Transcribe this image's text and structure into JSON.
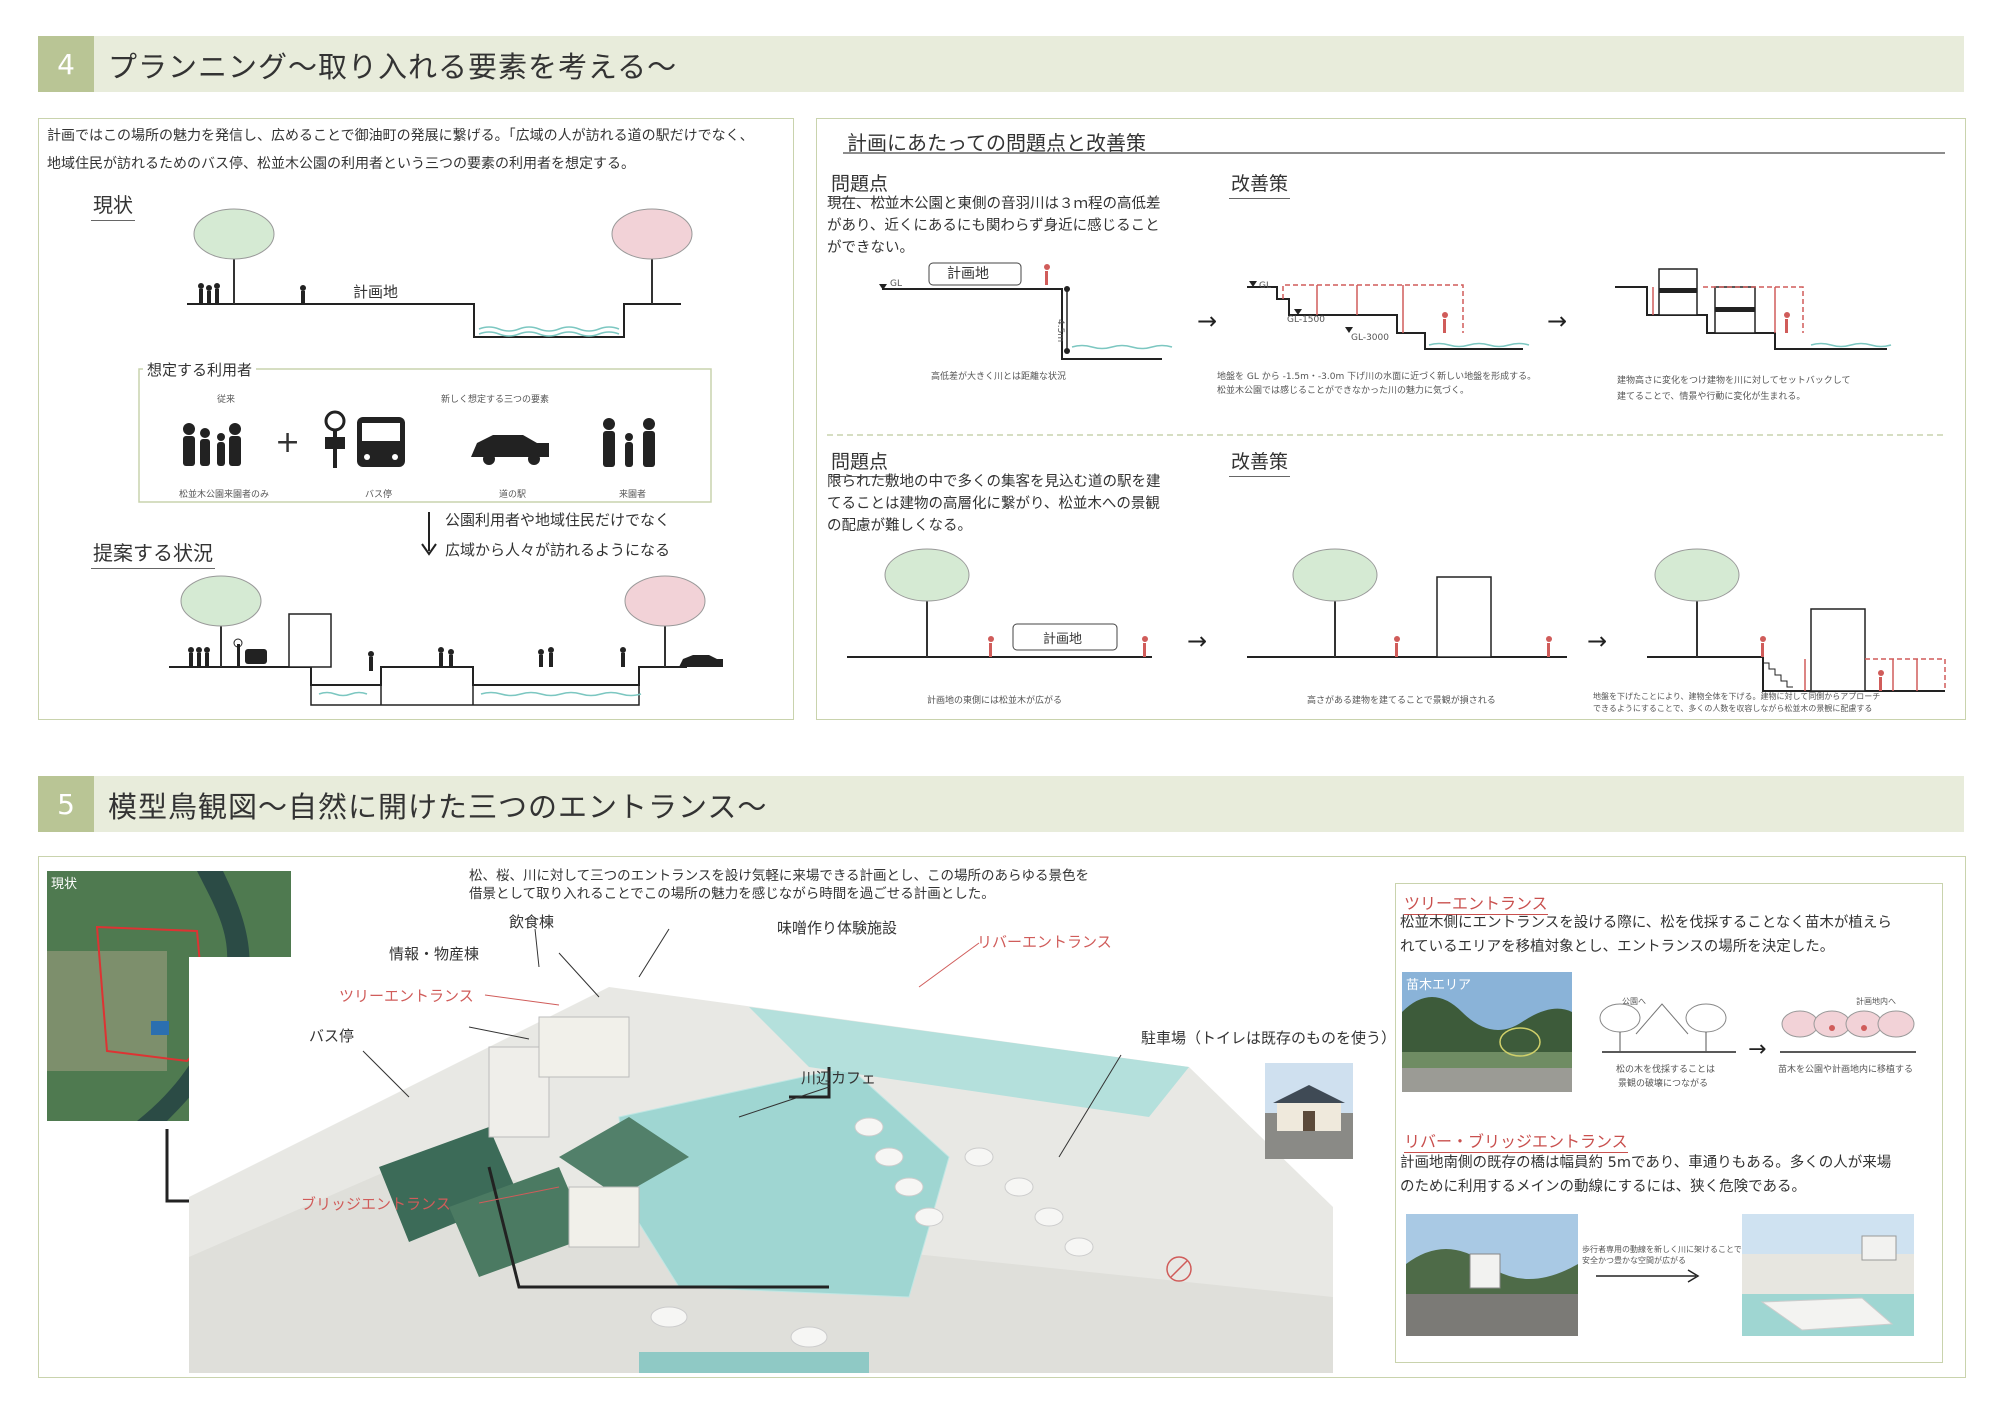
{
  "section4": {
    "num": "4",
    "title": "プランニング〜取り入れる要素を考える〜",
    "intro_line1": "計画ではこの場所の魅力を発信し、広めることで御油町の発展に繋げる。「広域の人が訪れる道の駅だけでなく、",
    "intro_line2": "地域住民が訪れるためのバス停、松並木公園の利用者という三つの要素の利用者を想定する。",
    "current_label": "現状",
    "site_label": "計画地",
    "users_title": "想定する利用者",
    "users_conventional": "従来",
    "users_new": "新しく想定する三つの要素",
    "user_park": "松並木公園来園者のみ",
    "user_bus": "バス停",
    "user_roadside": "道の駅",
    "user_visitor": "来園者",
    "plus": "+",
    "arrow_text1": "公園利用者や地域住民だけでなく",
    "arrow_text2": "広域から人々が訪れるようになる",
    "proposal_label": "提案する状況",
    "problems": {
      "title": "計画にあたっての問題点と改善策",
      "problem_label": "問題点",
      "solution_label": "改善策",
      "p1_line1": "現在、松並木公園と東側の音羽川は３ｍ程の高低差",
      "p1_line2": "があり、近くにあるにも関わらず身近に感じること",
      "p1_line3": "ができない。",
      "p1_site": "計画地",
      "p1_gl": "GL",
      "p1_height": "4.5m",
      "p1_gl1500": "GL-1500",
      "p1_gl3000": "GL-3000",
      "p1_cap1": "高低差が大きく川とは距離な状況",
      "p1_cap2_line1": "地盤を GL から -1.5m・-3.0m 下げ川の水面に近づく新しい地盤を形成する。",
      "p1_cap2_line2": "松並木公園では感じることができなかった川の魅力に気づく。",
      "p1_cap3_line1": "建物高さに変化をつけ建物を川に対してセットバックして",
      "p1_cap3_line2": "建てることで、情景や行動に変化が生まれる。",
      "p2_line1": "限られた敷地の中で多くの集客を見込む道の駅を建",
      "p2_line2": "てることは建物の高層化に繋がり、松並木への景観",
      "p2_line3": "の配慮が難しくなる。",
      "p2_site": "計画地",
      "p2_cap1": "計画地の東側には松並木が広がる",
      "p2_cap2": "高さがある建物を建てることで景観が損される",
      "p2_cap3_line1": "地盤を下げたことにより、建物全体を下げる。建物に対して同側からアプローチ",
      "p2_cap3_line2": "できるようにすることで、多くの人数を収容しながら松並木の景観に配慮する",
      "arrow": "→"
    }
  },
  "section5": {
    "num": "5",
    "title": "模型鳥観図〜自然に開けた三つのエントランス〜",
    "aerial_label": "現状",
    "desc_line1": "松、桜、川に対して三つのエントランスを設け気軽に来場できる計画とし、この場所のあらゆる景色を",
    "desc_line2": "借景として取り入れることでこの場所の魅力を感じながら時間を過ごせる計画とした。",
    "labels": {
      "restaurant": "飲食棟",
      "miso": "味噌作り体験施設",
      "info": "情報・物産棟",
      "river_entrance": "リバーエントランス",
      "tree_entrance": "ツリーエントランス",
      "bus_stop": "バス停",
      "parking": "駐車場（トイレは既存のものを使う）",
      "cafe": "川辺カフェ",
      "bridge_entrance": "ブリッジエントランス"
    },
    "tree": {
      "title": "ツリーエントランス",
      "line1": "松並木側にエントランスを設ける際に、松を伐採することなく苗木が植えら",
      "line2": "れているエリアを移植対象とし、エントランスの場所を決定した。",
      "photo_label": "苗木エリア",
      "cap1_line1": "松の木を伐採することは",
      "cap1_line2": "景観の破壊につながる",
      "cap2": "苗木を公園や計画地内に移植する",
      "tag1": "公園へ",
      "tag2": "計画地内へ"
    },
    "bridge": {
      "title": "リバー・ブリッジエントランス",
      "line1": "計画地南側の既存の橋は幅員約 5mであり、車通りもある。多くの人が来場",
      "line2": "のために利用するメインの動線にするには、狭く危険である。",
      "note_line1": "歩行者専用の動線を新しく川に架けることで",
      "note_line2": "安全かつ豊かな空間が広がる"
    }
  },
  "colors": {
    "band": "#e8ecdb",
    "band_num": "#b9c595",
    "panel_border": "#c9d3ad",
    "accent_red": "#d05c5a",
    "tree_green": "#cfe6cf",
    "tree_pink": "#f1cdd3",
    "water": "#9fd6d2"
  }
}
